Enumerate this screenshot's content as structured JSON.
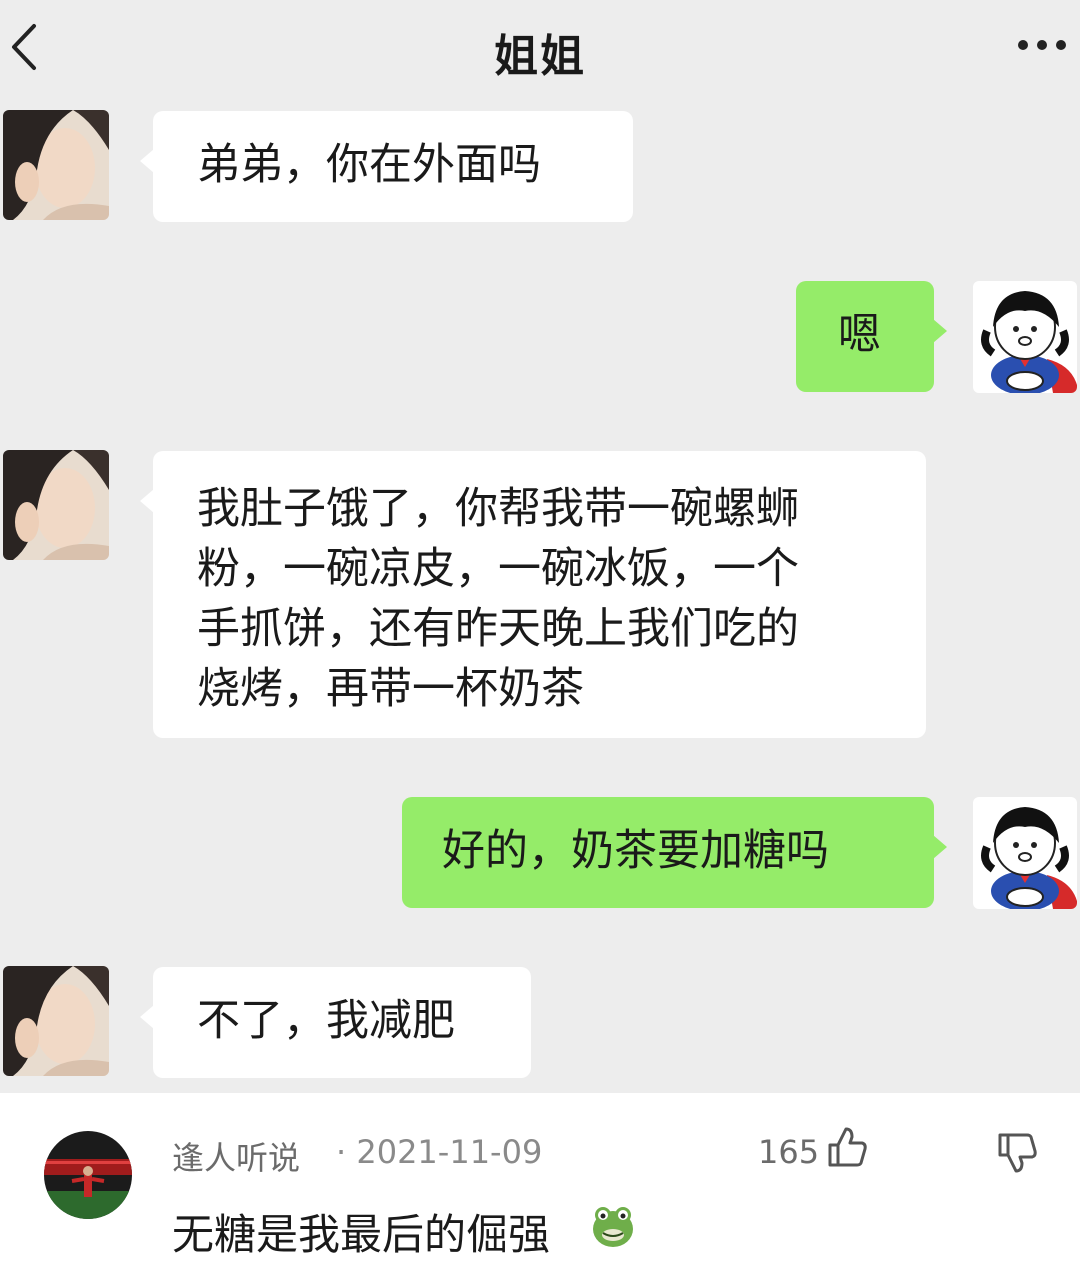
{
  "chat": {
    "title": "姐姐",
    "messages": [
      {
        "side": "in",
        "text": "弟弟，你在外面吗"
      },
      {
        "side": "out",
        "text": "嗯"
      },
      {
        "side": "in",
        "lines": [
          "我肚子饿了，你帮我带一碗螺蛳",
          "粉，一碗凉皮，一碗冰饭，一个",
          "手抓饼，还有昨天晚上我们吃的",
          "烧烤，再带一杯奶茶"
        ]
      },
      {
        "side": "out",
        "text": "好的，奶茶要加糖吗"
      },
      {
        "side": "in",
        "text": "不了，我减肥"
      }
    ]
  },
  "comment": {
    "username": "逢人听说",
    "date": "· 2021-11-09",
    "likes": "165",
    "text": "无糖是我最后的倔强",
    "emoji": "frog-emoji"
  },
  "colors": {
    "chat_bg": "#ededed",
    "incoming_bubble": "#ffffff",
    "outgoing_bubble": "#95ec69"
  }
}
